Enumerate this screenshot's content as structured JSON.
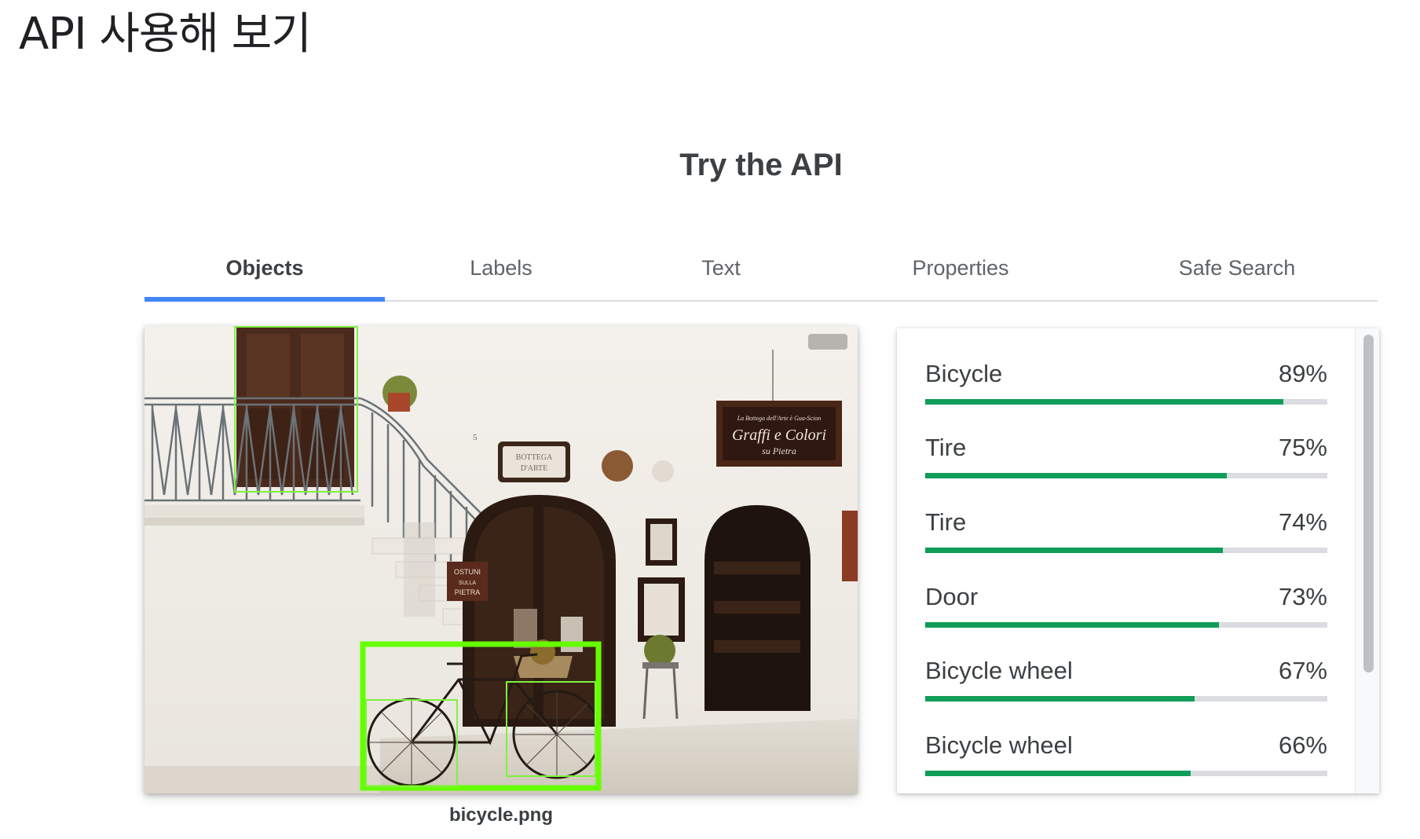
{
  "page": {
    "heading": "API 사용해 보기"
  },
  "demo": {
    "title": "Try the API",
    "tabs": [
      {
        "label": "Objects",
        "active": true
      },
      {
        "label": "Labels",
        "active": false
      },
      {
        "label": "Text",
        "active": false
      },
      {
        "label": "Properties",
        "active": false
      },
      {
        "label": "Safe Search",
        "active": false
      }
    ],
    "image": {
      "filename": "bicycle.png",
      "sign_lines": [
        "La Bottega dell'Arte è Gua-Scion",
        "Graffi e Colori",
        "su Pietra"
      ],
      "plaque_lines": [
        "BOTTEGA",
        "D'ARTE"
      ],
      "step_sign_lines": [
        "OSTUNI",
        "SULLA",
        "PIETRA"
      ]
    },
    "results": [
      {
        "label": "Bicycle",
        "percent": "89%",
        "score": 0.89
      },
      {
        "label": "Tire",
        "percent": "75%",
        "score": 0.75
      },
      {
        "label": "Tire",
        "percent": "74%",
        "score": 0.74
      },
      {
        "label": "Door",
        "percent": "73%",
        "score": 0.73
      },
      {
        "label": "Bicycle wheel",
        "percent": "67%",
        "score": 0.67
      },
      {
        "label": "Bicycle wheel",
        "percent": "66%",
        "score": 0.66
      }
    ],
    "colors": {
      "tab_indicator": "#4285f4",
      "bar_fill": "#0f9d58",
      "bar_track": "#dadce0",
      "bbox_bright": "#66ff00",
      "bbox_thin": "#7ff23c"
    }
  }
}
